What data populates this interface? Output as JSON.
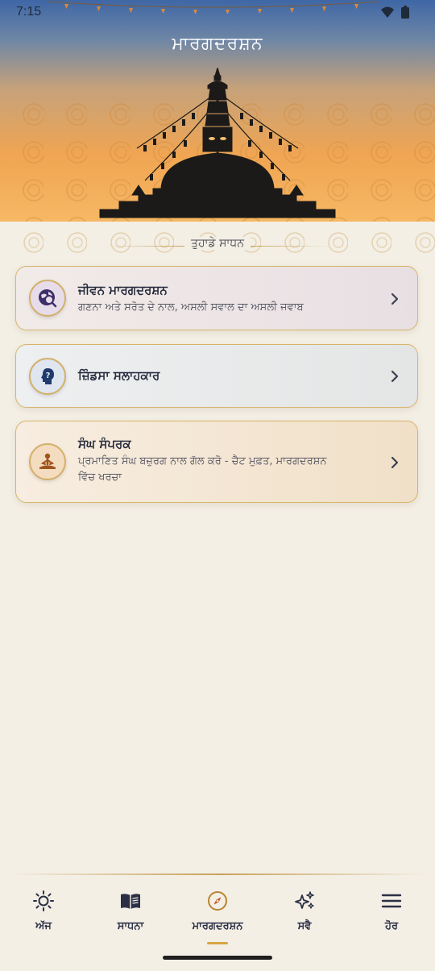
{
  "status_bar": {
    "time": "7:15"
  },
  "header": {
    "title": "ਮਾਰਗਦਰਸ਼ਨ"
  },
  "section": {
    "heading": "ਤੁਹਾਡੇ ਸਾਧਨ"
  },
  "cards": [
    {
      "title": "ਜੀਵਨ ਮਾਰਗਦਰਸ਼ਨ",
      "subtitle": "ਗਣਨਾ ਅਤੇ ਸਰੋਤ ਦੇ ਨਾਲ, ਅਸਲੀ ਸਵਾਲ ਦਾ ਅਸਲੀ ਜਵਾਬ",
      "icon": "globe-search-icon"
    },
    {
      "title": "ਜ਼ਿੰਡਸਾ ਸਲਾਹਕਾਰ",
      "subtitle": "",
      "icon": "head-question-icon"
    },
    {
      "title": "ਸੰਘ ਸੰਪਰਕ",
      "subtitle_line1": "ਪ੍ਰਮਾਣਿਤ ਸੰਘ ਬਜ਼ੁਰਗ ਨਾਲ ਗੱਲ ਕਰੋ - ਚੈਟ ਮੁਫ਼ਤ, ਮਾਰਗਦਰਸ਼ਨ",
      "subtitle_line2": "ਵਿੱਚ ਖਰਚਾ",
      "icon": "meditation-icon"
    }
  ],
  "nav": {
    "items": [
      {
        "label": "ਅੱਜ",
        "icon": "sun-icon",
        "active": false
      },
      {
        "label": "ਸਾਧਨਾ",
        "icon": "book-icon",
        "active": false
      },
      {
        "label": "ਮਾਰਗਦਰਸ਼ਨ",
        "icon": "compass-icon",
        "active": true
      },
      {
        "label": "ਸਵੈ",
        "icon": "sparkles-icon",
        "active": false
      },
      {
        "label": "ਹੋਰ",
        "icon": "menu-icon",
        "active": false
      }
    ]
  },
  "colors": {
    "accent_gold": "#d7b46a",
    "nav_text": "#2b2f45",
    "background": "#f3efe5",
    "sky_top": "#3f67a6",
    "sky_bottom": "#f6b864"
  }
}
